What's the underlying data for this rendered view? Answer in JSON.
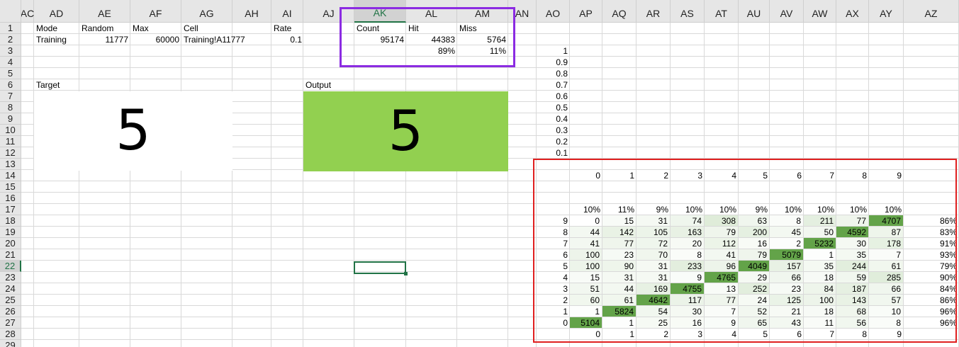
{
  "columns": [
    "AC",
    "AD",
    "AE",
    "AF",
    "AG",
    "AH",
    "AI",
    "AJ",
    "AK",
    "AL",
    "AM",
    "AN",
    "AO",
    "AP",
    "AQ",
    "AR",
    "AS",
    "AT",
    "AU",
    "AV",
    "AW",
    "AX",
    "AY",
    "AZ"
  ],
  "rows": [
    "1",
    "2",
    "3",
    "4",
    "5",
    "6",
    "7",
    "8",
    "9",
    "10",
    "11",
    "12",
    "13",
    "14",
    "15",
    "16",
    "17",
    "18",
    "19",
    "20",
    "21",
    "22",
    "23",
    "24",
    "25",
    "26",
    "27",
    "28",
    "29"
  ],
  "selected_column": "AK",
  "selected_row": "22",
  "info": {
    "mode_label": "Mode",
    "mode_value": "Training",
    "random_label": "Random",
    "random_value": "11777",
    "max_label": "Max",
    "max_value": "60000",
    "cell_label": "Cell",
    "cell_value": "Training!A11777",
    "rate_label": "Rate",
    "rate_value": "0.1"
  },
  "stats": {
    "count_label": "Count",
    "count_value": "95174",
    "hit_label": "Hit",
    "hit_value": "44383",
    "hit_pct": "89%",
    "miss_label": "Miss",
    "miss_value": "5764",
    "miss_pct": "11%"
  },
  "target": {
    "label": "Target",
    "digit": "5"
  },
  "output": {
    "label": "Output",
    "digit": "5",
    "fill_color": "#92d050"
  },
  "scale_labels": [
    "1",
    "0.9",
    "0.8",
    "0.7",
    "0.6",
    "0.5",
    "0.4",
    "0.3",
    "0.2",
    "0.1"
  ],
  "confusion": {
    "header_digits": [
      "0",
      "1",
      "2",
      "3",
      "4",
      "5",
      "6",
      "7",
      "8",
      "9"
    ],
    "column_pcts": [
      "10%",
      "11%",
      "9%",
      "10%",
      "10%",
      "9%",
      "10%",
      "10%",
      "10%",
      "10%"
    ],
    "rows": [
      {
        "label": "9",
        "values": [
          "0",
          "15",
          "31",
          "74",
          "308",
          "63",
          "8",
          "211",
          "77",
          "4707"
        ],
        "pct": "86%"
      },
      {
        "label": "8",
        "values": [
          "44",
          "142",
          "105",
          "163",
          "79",
          "200",
          "45",
          "50",
          "4592",
          "87"
        ],
        "pct": "83%"
      },
      {
        "label": "7",
        "values": [
          "41",
          "77",
          "72",
          "20",
          "112",
          "16",
          "2",
          "5232",
          "30",
          "178"
        ],
        "pct": "91%"
      },
      {
        "label": "6",
        "values": [
          "100",
          "23",
          "70",
          "8",
          "41",
          "79",
          "5079",
          "1",
          "35",
          "7"
        ],
        "pct": "93%"
      },
      {
        "label": "5",
        "values": [
          "100",
          "90",
          "31",
          "233",
          "96",
          "4049",
          "157",
          "35",
          "244",
          "61"
        ],
        "pct": "79%"
      },
      {
        "label": "4",
        "values": [
          "15",
          "31",
          "31",
          "9",
          "4765",
          "29",
          "66",
          "18",
          "59",
          "285"
        ],
        "pct": "90%"
      },
      {
        "label": "3",
        "values": [
          "51",
          "44",
          "169",
          "4755",
          "13",
          "252",
          "23",
          "84",
          "187",
          "66"
        ],
        "pct": "84%"
      },
      {
        "label": "2",
        "values": [
          "60",
          "61",
          "4642",
          "117",
          "77",
          "24",
          "125",
          "100",
          "143",
          "57"
        ],
        "pct": "86%"
      },
      {
        "label": "1",
        "values": [
          "1",
          "5824",
          "54",
          "30",
          "7",
          "52",
          "21",
          "18",
          "68",
          "10"
        ],
        "pct": "96%"
      },
      {
        "label": "0",
        "values": [
          "5104",
          "1",
          "25",
          "16",
          "9",
          "65",
          "43",
          "11",
          "56",
          "8"
        ],
        "pct": "96%"
      }
    ],
    "footer_digits": [
      "0",
      "1",
      "2",
      "3",
      "4",
      "5",
      "6",
      "7",
      "8",
      "9"
    ]
  },
  "colors": {
    "stats_box": "#8b2be2",
    "matrix_box": "#e02020",
    "heat_strong": "#63a349",
    "heat_light": "#eaf4e5",
    "selection": "#217346"
  }
}
